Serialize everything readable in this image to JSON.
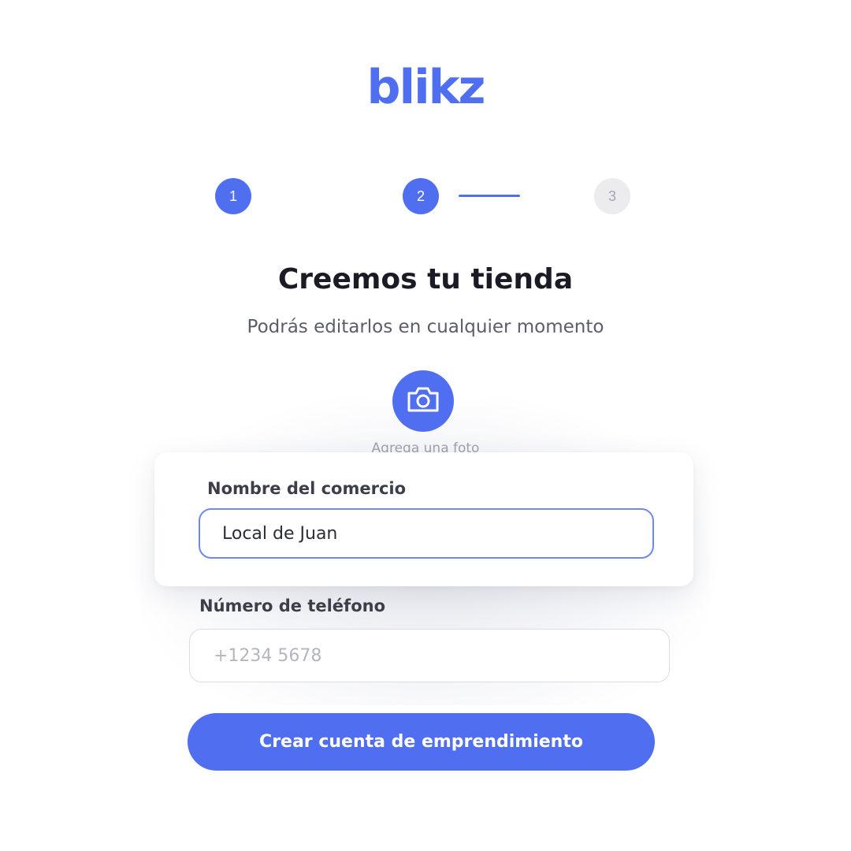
{
  "brand": {
    "logo_text": "blikz",
    "accent_color": "#4f6ff0"
  },
  "stepper": {
    "steps": [
      {
        "label": "1",
        "state": "completed"
      },
      {
        "label": "2",
        "state": "active"
      },
      {
        "label": "3",
        "state": "inactive"
      }
    ]
  },
  "header": {
    "title": "Creemos tu tienda",
    "subtitle": "Podrás editarlos en cualquier momento"
  },
  "photo": {
    "icon": "camera-icon",
    "label": "Agrega una foto"
  },
  "form": {
    "store_name": {
      "label": "Nombre del comercio",
      "value": "Local de Juan"
    },
    "phone": {
      "label": "Número de teléfono",
      "placeholder": "+1234 5678",
      "value": ""
    },
    "submit_label": "Crear cuenta de emprendimiento"
  }
}
